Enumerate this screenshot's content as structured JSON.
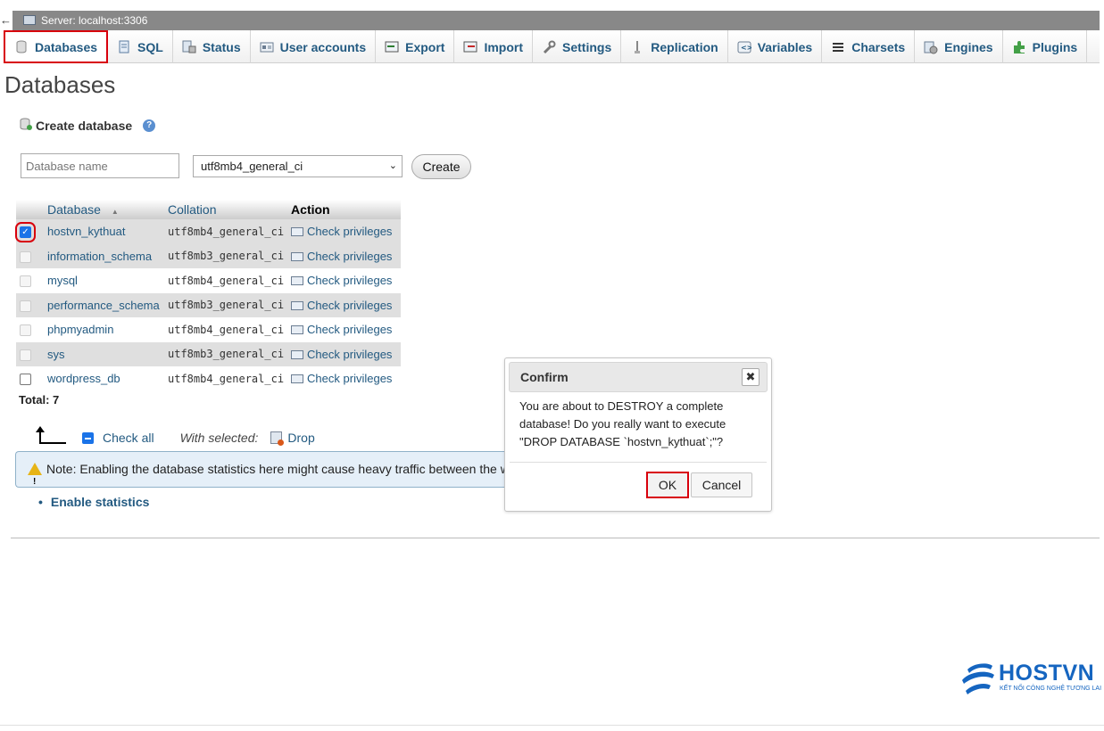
{
  "server_bar": {
    "title": "Server: localhost:3306"
  },
  "tabs": [
    {
      "label": "Databases",
      "icon": "database-icon",
      "active": true
    },
    {
      "label": "SQL",
      "icon": "sql-icon"
    },
    {
      "label": "Status",
      "icon": "status-icon"
    },
    {
      "label": "User accounts",
      "icon": "user-accounts-icon"
    },
    {
      "label": "Export",
      "icon": "export-icon"
    },
    {
      "label": "Import",
      "icon": "import-icon"
    },
    {
      "label": "Settings",
      "icon": "wrench-icon"
    },
    {
      "label": "Replication",
      "icon": "replication-icon"
    },
    {
      "label": "Variables",
      "icon": "variables-icon"
    },
    {
      "label": "Charsets",
      "icon": "charsets-icon"
    },
    {
      "label": "Engines",
      "icon": "engines-icon"
    },
    {
      "label": "Plugins",
      "icon": "plugins-icon"
    }
  ],
  "page": {
    "title": "Databases"
  },
  "create_db": {
    "label": "Create database",
    "name_placeholder": "Database name",
    "collation_selected": "utf8mb4_general_ci",
    "create_button": "Create"
  },
  "db_table": {
    "headers": {
      "database": "Database",
      "sort_indicator": "▲",
      "collation": "Collation",
      "action": "Action"
    },
    "rows": [
      {
        "name": "hostvn_kythuat",
        "collation": "utf8mb4_general_ci",
        "action": "Check privileges",
        "checked": true
      },
      {
        "name": "information_schema",
        "collation": "utf8mb3_general_ci",
        "action": "Check privileges",
        "checked": false
      },
      {
        "name": "mysql",
        "collation": "utf8mb4_general_ci",
        "action": "Check privileges",
        "checked": false
      },
      {
        "name": "performance_schema",
        "collation": "utf8mb3_general_ci",
        "action": "Check privileges",
        "checked": false
      },
      {
        "name": "phpmyadmin",
        "collation": "utf8mb4_general_ci",
        "action": "Check privileges",
        "checked": false
      },
      {
        "name": "sys",
        "collation": "utf8mb3_general_ci",
        "action": "Check privileges",
        "checked": false
      },
      {
        "name": "wordpress_db",
        "collation": "utf8mb4_general_ci",
        "action": "Check privileges",
        "checked": false
      }
    ],
    "total": "Total: 7"
  },
  "bulk": {
    "check_all": "Check all",
    "with_selected": "With selected:",
    "drop": "Drop"
  },
  "notice": {
    "text": "Note: Enabling the database statistics here might cause heavy traffic between the web server"
  },
  "enable_stats": "Enable statistics",
  "dialog": {
    "title": "Confirm",
    "close": "✖",
    "message": "You are about to DESTROY a complete database! Do you really want to execute \"DROP DATABASE `hostvn_kythuat`;\"?",
    "ok": "OK",
    "cancel": "Cancel"
  },
  "logo": {
    "name": "HOSTVN",
    "tagline": "KẾT NỐI CÔNG NGHỆ TƯƠNG LAI"
  },
  "colors": {
    "link": "#235a81",
    "highlight": "#d8000c",
    "server_bar": "#888888"
  }
}
